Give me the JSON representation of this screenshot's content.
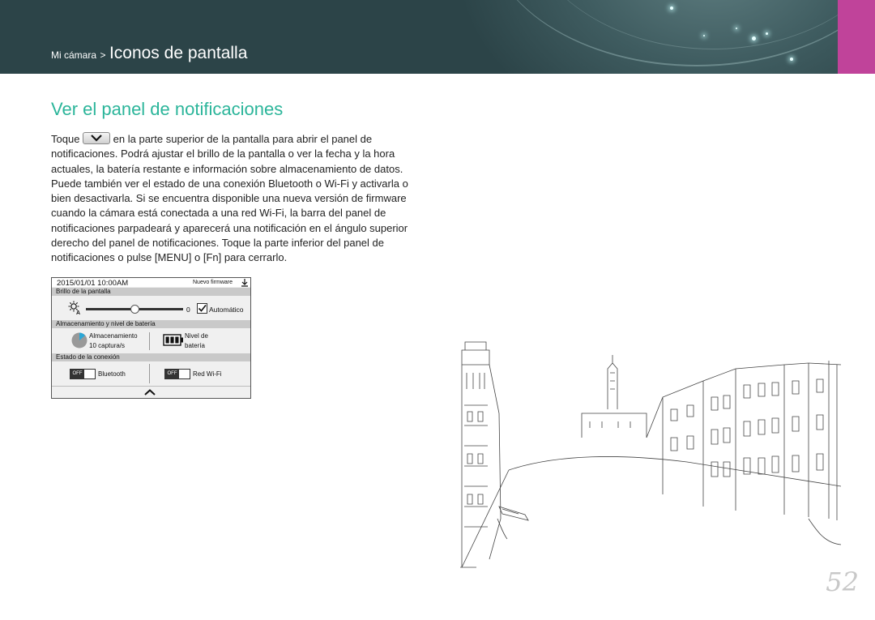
{
  "header": {
    "crumb_parent": "Mi cámara",
    "crumb_sep": ">",
    "crumb_current": "Iconos de pantalla"
  },
  "section_title": "Ver el panel de notificaciones",
  "paragraph": {
    "line1_pre": "Toque",
    "line1_post": "en la parte superior de la pantalla para abrir el panel de",
    "lines": [
      "notificaciones. Podrá ajustar el brillo de la pantalla o ver la fecha y la hora",
      "actuales, la batería restante e información sobre almacenamiento de datos.",
      "Puede también ver el estado de una conexión Bluetooth o Wi-Fi y activarla o",
      "bien desactivarla. Si se encuentra disponible una nueva versión de firmware",
      "cuando la cámara está conectada a una red Wi-Fi, la barra del panel de",
      "notificaciones parpadeará y aparecerá una notificación en el ángulo superior",
      "derecho del panel de notificaciones. Toque la parte inferior del panel de"
    ],
    "last_line": "notificaciones o pulse [MENU] o [Fn] para cerrarlo."
  },
  "panel": {
    "datetime": "2015/01/01   10:00AM",
    "firmware": "Nuevo firmware",
    "brightness_label": "Brillo de la pantalla",
    "brightness_value": "0",
    "brightness_level": 0.5,
    "auto_label": "Automático",
    "storage_header": "Almacenamiento y nivel de batería",
    "storage_label": "Almacenamiento",
    "storage_rate": "10 captura/s",
    "battery_label_1": "Nivel de",
    "battery_label_2": "batería",
    "connection_header": "Estado de la conexión",
    "bt_state": "OFF",
    "bt_label": "Bluetooth",
    "wifi_state": "OFF",
    "wifi_label": "Red Wi-Fi"
  },
  "page_number": "52",
  "colors": {
    "accent": "#2bb59a",
    "header_bg": "#2c4448",
    "pink_tab": "#c0439a"
  }
}
